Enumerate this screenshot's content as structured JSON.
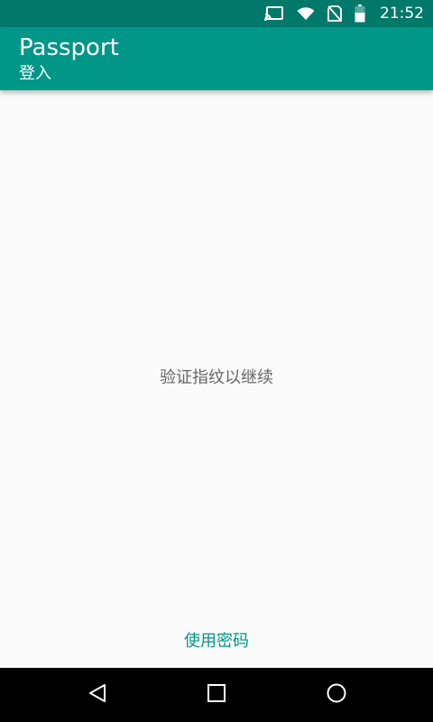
{
  "status_bar": {
    "time": "21:52",
    "icons": [
      "cast-icon",
      "wifi-icon",
      "no-sim-icon",
      "battery-icon"
    ]
  },
  "app_bar": {
    "title": "Passport",
    "subtitle": "登入"
  },
  "main": {
    "prompt": "验证指纹以继续",
    "use_password_label": "使用密码"
  },
  "nav_bar": {
    "buttons": [
      "back-icon",
      "home-icon",
      "recents-icon"
    ]
  },
  "colors": {
    "status_bar": "#00796b",
    "app_bar": "#009688",
    "accent": "#009688",
    "background": "#fafafa",
    "nav_bar": "#000000"
  }
}
